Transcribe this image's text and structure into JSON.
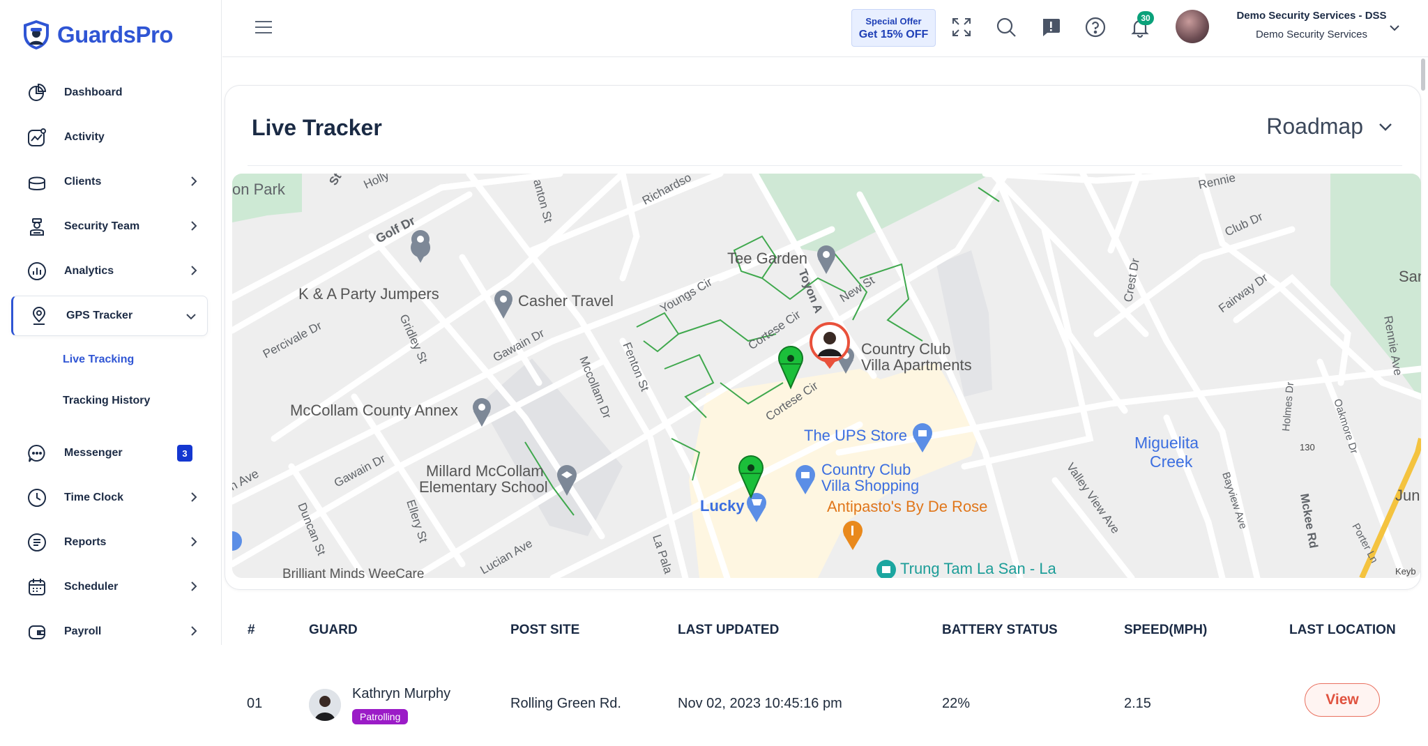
{
  "brand": {
    "name": "GuardsPro"
  },
  "sidebar": {
    "items": [
      {
        "label": "Dashboard",
        "icon": "pie-chart-icon"
      },
      {
        "label": "Activity",
        "icon": "activity-chart-icon"
      },
      {
        "label": "Clients",
        "icon": "clients-icon"
      },
      {
        "label": "Security Team",
        "icon": "security-team-icon"
      },
      {
        "label": "Analytics",
        "icon": "analytics-icon"
      },
      {
        "label": "GPS Tracker",
        "icon": "location-pin-icon"
      },
      {
        "label": "Messenger",
        "icon": "chat-icon",
        "badge": "3"
      },
      {
        "label": "Time Clock",
        "icon": "clock-icon"
      },
      {
        "label": "Reports",
        "icon": "document-icon"
      },
      {
        "label": "Scheduler",
        "icon": "calendar-icon"
      },
      {
        "label": "Payroll",
        "icon": "wallet-icon"
      }
    ],
    "sub_items": [
      {
        "label": "Live Tracking",
        "active": true
      },
      {
        "label": "Tracking History",
        "active": false
      }
    ]
  },
  "header": {
    "offer_line1": "Special Offer",
    "offer_line2": "Get 15% OFF",
    "notifications": "30",
    "org_name": "Demo Security Services - DSS",
    "org_sub": "Demo Security Services"
  },
  "card": {
    "title": "Live Tracker",
    "map_type": "Roadmap"
  },
  "map": {
    "labels": {
      "l1": "on Park",
      "l2": "St",
      "l3": "Holly",
      "l4": "Golf Dr",
      "l5": "anton St",
      "l6": "Richardso",
      "l7": "Tee Garden",
      "l8": "Rennie",
      "l9": "Club Dr",
      "l10": "San",
      "l11": "K & A Party Jumpers",
      "l12": "Casher Travel",
      "l13": "Youngs Cir",
      "l14": "Toyon A",
      "l15": "New St",
      "l16": "Crest Dr",
      "l17": "Fairway Dr",
      "l18": "Percivale Dr",
      "l19": "Gridley St",
      "l20": "Gawain Dr",
      "l21": "Cortese Cir",
      "l22": "Country Club",
      "l23": "Villa Apartments",
      "l24": "Rennie Ave",
      "l25": "McCollam County Annex",
      "l26": "Mccollam Dr",
      "l27": "Fenton St",
      "l28": "Cortese Cir",
      "l29": "The UPS Store",
      "l30": "Miguelita",
      "l31": "Creek",
      "l32": "Holmes Dr",
      "l33": "Oakmore Dr",
      "l34": "Gawain Dr",
      "l35": "Millard McCollam",
      "l36": "Elementary School",
      "l37": "Country Club",
      "l38": "Villa Shopping",
      "l39": "Valley View Ave",
      "l40": "Bayview Ave",
      "l41": "130",
      "l42": "n Ave",
      "l43": "Lucky",
      "l44": "Antipasto's By De Rose",
      "l45": "Jun",
      "l46": "Duncan St",
      "l47": "Ellery St",
      "l48": "Lucian Ave",
      "l49": "La Pala",
      "l50": "Mckee Rd",
      "l51": "Porter Ln",
      "l52": "Brilliant Minds WeeCare",
      "l53": "Trung Tam La San - La",
      "l54": "Keyb"
    }
  },
  "table": {
    "headers": [
      "#",
      "GUARD",
      "POST SITE",
      "LAST UPDATED",
      "BATTERY STATUS",
      "SPEED(MPH)",
      "LAST LOCATION"
    ],
    "rows": [
      {
        "num": "01",
        "guard": "Kathryn Murphy",
        "status": "Patrolling",
        "post_site": "Rolling Green Rd.",
        "last_updated": "Nov 02, 2023 10:45:16 pm",
        "battery": "22%",
        "speed": "2.15",
        "action": "View"
      }
    ]
  },
  "colors": {
    "accent": "#2f55d4",
    "status": "#9b1bc7",
    "view": "#e0523f",
    "badge": "#1437d0",
    "notif": "#0aa17a"
  }
}
